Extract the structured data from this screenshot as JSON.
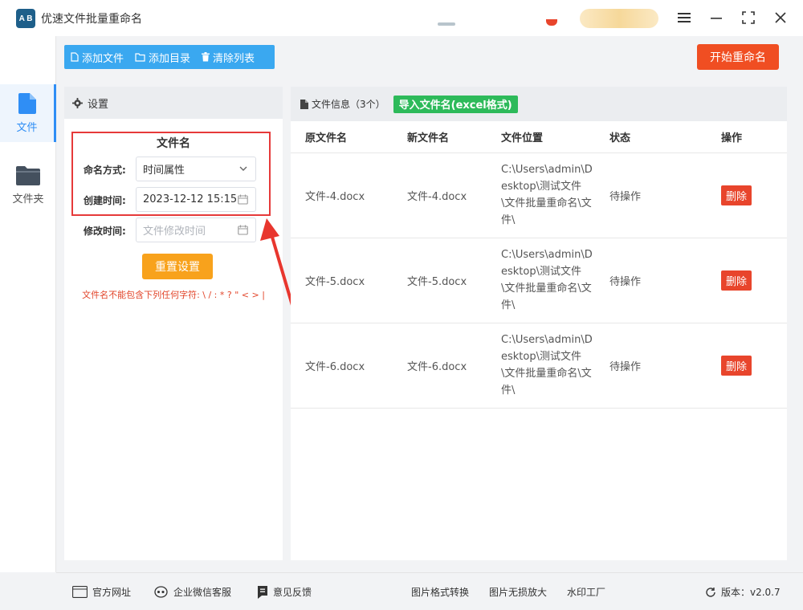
{
  "app": {
    "title": "优速文件批量重命名",
    "logo_text": "A B"
  },
  "window_controls": {
    "menu": "☰",
    "minimize": "—",
    "maximize": "⛶",
    "close": "✕"
  },
  "nav": {
    "items": [
      {
        "label": "文件",
        "icon": "file-icon",
        "active": true
      },
      {
        "label": "文件夹",
        "icon": "folder-icon",
        "active": false
      }
    ]
  },
  "toolbar": {
    "add_file": "添加文件",
    "add_dir": "添加目录",
    "clear_list": "清除列表",
    "start": "开始重命名"
  },
  "settings": {
    "header": "设置",
    "section_title": "文件名",
    "naming_label": "命名方式:",
    "naming_value": "时间属性",
    "created_label": "创建时间:",
    "created_value": "2023-12-12 15:15",
    "modified_label": "修改时间:",
    "modified_placeholder": "文件修改时间",
    "reset": "重置设置",
    "warning": "文件名不能包含下列任何字符: \\ / : * ? \" < > |"
  },
  "files": {
    "header": "文件信息（3个）",
    "import_button": "导入文件名(excel格式)",
    "columns": [
      "原文件名",
      "新文件名",
      "文件位置",
      "状态",
      "操作"
    ],
    "rows": [
      {
        "original": "文件-4.docx",
        "new": "文件-4.docx",
        "path": "C:\\Users\\admin\\Desktop\\测试文件\\文件批量重命名\\文件\\",
        "status": "待操作",
        "action": "删除"
      },
      {
        "original": "文件-5.docx",
        "new": "文件-5.docx",
        "path": "C:\\Users\\admin\\Desktop\\测试文件\\文件批量重命名\\文件\\",
        "status": "待操作",
        "action": "删除"
      },
      {
        "original": "文件-6.docx",
        "new": "文件-6.docx",
        "path": "C:\\Users\\admin\\Desktop\\测试文件\\文件批量重命名\\文件\\",
        "status": "待操作",
        "action": "删除"
      }
    ]
  },
  "footer": {
    "website": "官方网址",
    "wechat": "企业微信客服",
    "feedback": "意见反馈",
    "img_convert": "图片格式转换",
    "img_enlarge": "图片无损放大",
    "watermark": "水印工厂",
    "version": "版本：v2.0.7"
  },
  "colors": {
    "accent_blue": "#3aa8f0",
    "start_orange": "#f04e22",
    "reset_orange": "#f8a21c",
    "import_green": "#2dba5a",
    "delete_red": "#e8452c",
    "warning_red": "#e2452a"
  }
}
